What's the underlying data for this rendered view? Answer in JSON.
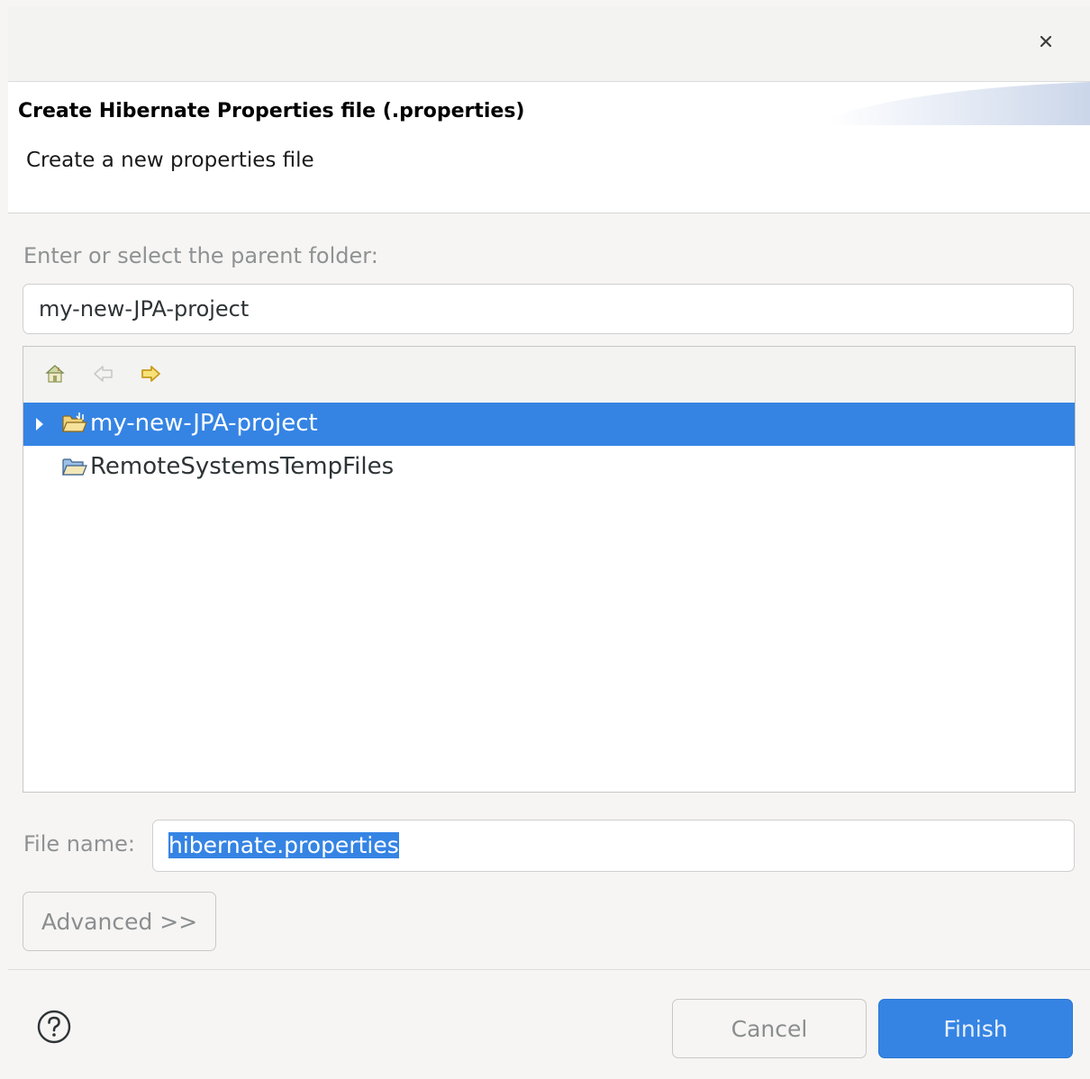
{
  "banner": {
    "title": "Create Hibernate Properties file (.properties)",
    "subtitle": "Create a new properties file"
  },
  "folder_section": {
    "label": "Enter or select the parent folder:",
    "value": "my-new-JPA-project"
  },
  "tree_toolbar": {
    "icons": [
      "home-icon",
      "back-arrow-icon",
      "forward-arrow-icon"
    ]
  },
  "tree": {
    "items": [
      {
        "label": "my-new-JPA-project",
        "selected": true,
        "expandable": true,
        "icon": "project-folder-icon"
      },
      {
        "label": "RemoteSystemsTempFiles",
        "selected": false,
        "expandable": false,
        "icon": "folder-icon"
      }
    ]
  },
  "file_name": {
    "label": "File name:",
    "value": "hibernate.properties"
  },
  "buttons": {
    "advanced": "Advanced >>",
    "cancel": "Cancel",
    "finish": "Finish"
  },
  "colors": {
    "accent": "#3584e4",
    "background": "#f6f5f4",
    "disabled_text": "#8f9293"
  }
}
